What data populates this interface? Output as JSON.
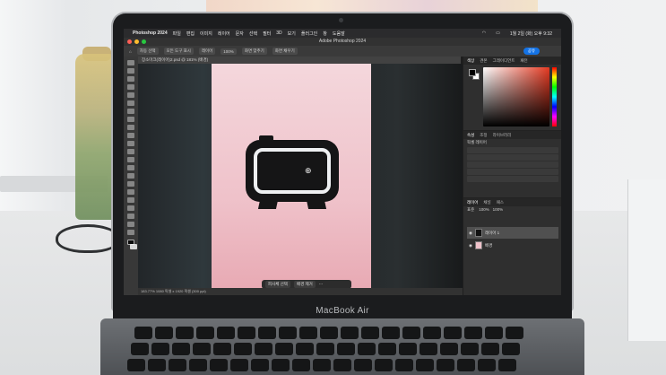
{
  "screen": {
    "menubar": {
      "app_name": "Photoshop 2024",
      "items": [
        "파일",
        "편집",
        "이미지",
        "레이어",
        "문자",
        "선택",
        "필터",
        "3D",
        "보기",
        "플러그인",
        "창",
        "도움말"
      ],
      "clock": "1월 2일 (화) 오후 9:32"
    },
    "window_title": "Adobe Photoshop 2024",
    "options_bar": {
      "items": [
        "자동 선택",
        "모든 도구 표시",
        "레이어",
        "100%",
        "화면 맞추기",
        "화면 채우기"
      ],
      "share_label": "공유"
    },
    "document_tab": "장소마크(레이어)2.psd @ 181% (배경)",
    "status_text": "183.77% 1080 픽셀 x 1920 픽셀 (300 ppi)",
    "context_bar": {
      "select_subject": "피사체 선택",
      "remove_bg": "배경 제거"
    },
    "panels": {
      "color_tabs": [
        "색상",
        "견본",
        "그레이디언트",
        "패턴"
      ],
      "properties_tabs": [
        "속성",
        "조정",
        "라이브러리"
      ],
      "properties_label": "픽셀 레이어",
      "layers_tabs": [
        "레이어",
        "채널",
        "패스"
      ],
      "blend_mode": "표준",
      "opacity": "100%",
      "fill": "100%",
      "layers": [
        {
          "name": "레이어 1",
          "selected": true
        },
        {
          "name": "배경",
          "selected": false
        }
      ]
    }
  },
  "laptop_label": "MacBook Air",
  "colors": {
    "artboard_top": "#f4d7dc",
    "artboard_bottom": "#e8aab4",
    "accent": "#1473e6",
    "panel_bg": "#2f2f2f"
  }
}
